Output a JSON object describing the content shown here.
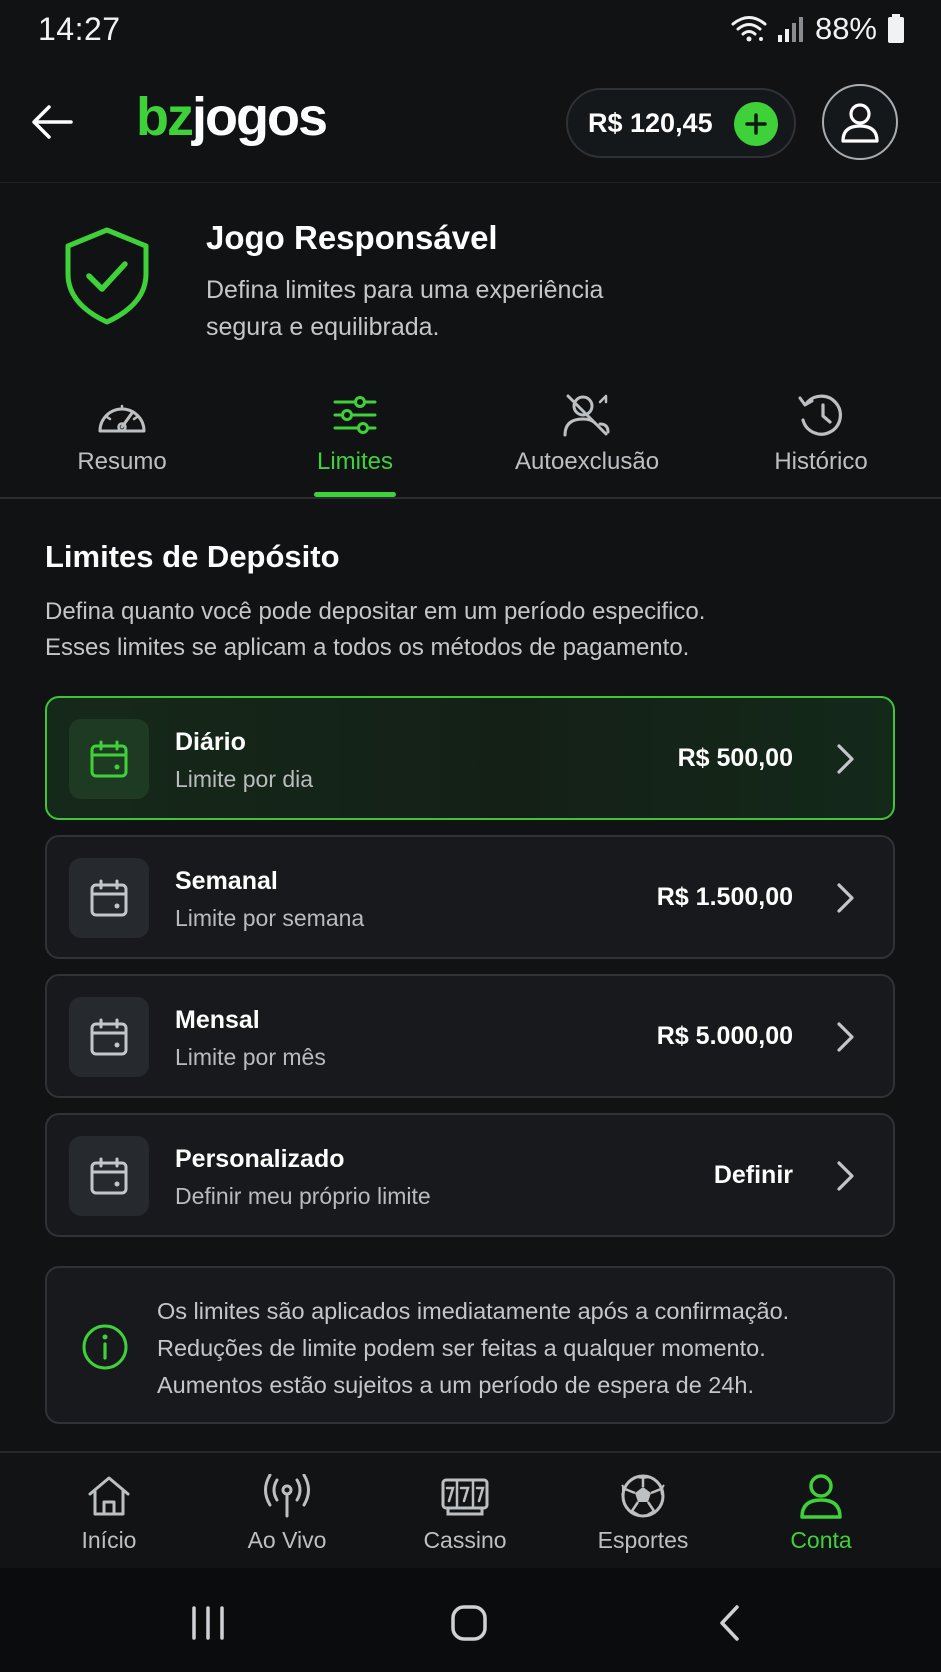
{
  "status_bar": {
    "time": "14:27",
    "battery": "88%"
  },
  "header": {
    "logo_part1": "bz",
    "logo_part2": "jogos",
    "balance": "R$ 120,45"
  },
  "hero": {
    "title": "Jogo Responsável",
    "subtitle": "Defina limites para uma experiência segura e equilibrada."
  },
  "tabs": [
    {
      "label": "Resumo",
      "icon": "gauge-icon",
      "active": false
    },
    {
      "label": "Limites",
      "icon": "sliders-icon",
      "active": true
    },
    {
      "label": "Autoexclusão",
      "icon": "user-block-icon",
      "active": false
    },
    {
      "label": "Histórico",
      "icon": "history-icon",
      "active": false
    }
  ],
  "section": {
    "title": "Limites de Depósito",
    "description_line1": "Defina quanto você pode depositar em um período especifico.",
    "description_line2": "Esses limites se aplicam a todos os métodos de pagamento."
  },
  "limits": [
    {
      "name": "Diário",
      "sub": "Limite por dia",
      "value": "R$ 500,00",
      "active": true
    },
    {
      "name": "Semanal",
      "sub": "Limite por semana",
      "value": "R$ 1.500,00",
      "active": false
    },
    {
      "name": "Mensal",
      "sub": "Limite por mês",
      "value": "R$ 5.000,00",
      "active": false
    },
    {
      "name": "Personalizado",
      "sub": "Definir meu próprio limite",
      "value": "Definir",
      "active": false
    }
  ],
  "info": {
    "line1": "Os limites são aplicados imediatamente após a confirmação.",
    "line2": "Reduções de limite podem ser feitas a qualquer momento.",
    "line3": "Aumentos estão sujeitos a um período de espera de 24h."
  },
  "bottom_nav": [
    {
      "label": "Início",
      "icon": "home-icon",
      "active": false
    },
    {
      "label": "Ao Vivo",
      "icon": "broadcast-icon",
      "active": false
    },
    {
      "label": "Cassino",
      "icon": "slot-machine-icon",
      "active": false
    },
    {
      "label": "Esportes",
      "icon": "soccer-ball-icon",
      "active": false
    },
    {
      "label": "Conta",
      "icon": "user-icon",
      "active": true
    }
  ],
  "colors": {
    "accent": "#3fd13a",
    "background": "#101214",
    "card": "#17191c",
    "muted_text": "#c4c7ca"
  }
}
